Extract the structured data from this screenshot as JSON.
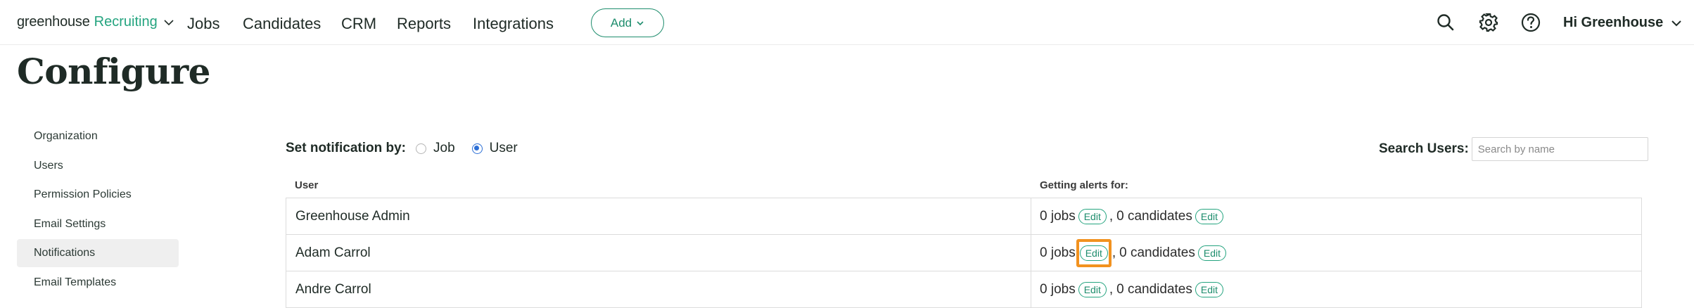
{
  "nav": {
    "brand_main": "greenhouse",
    "brand_sub": "Recruiting",
    "links": [
      "Jobs",
      "Candidates",
      "CRM",
      "Reports",
      "Integrations"
    ],
    "add_label": "Add",
    "user_label": "Hi Greenhouse"
  },
  "page": {
    "title": "Configure"
  },
  "sidebar": {
    "items": [
      {
        "label": "Organization",
        "active": false
      },
      {
        "label": "Users",
        "active": false
      },
      {
        "label": "Permission Policies",
        "active": false
      },
      {
        "label": "Email Settings",
        "active": false
      },
      {
        "label": "Notifications",
        "active": true
      },
      {
        "label": "Email Templates",
        "active": false
      }
    ]
  },
  "notifications": {
    "set_by_label": "Set notification by:",
    "options": [
      "Job",
      "User"
    ],
    "selected": "User",
    "search_label": "Search Users:",
    "search_placeholder": "Search by name",
    "search_value": ""
  },
  "table": {
    "columns": [
      "User",
      "Getting alerts for:"
    ],
    "rows": [
      {
        "user": "Greenhouse Admin",
        "jobs": "0 jobs",
        "candidates": "0 candidates"
      },
      {
        "user": "Adam Carrol",
        "jobs": "0 jobs",
        "candidates": "0 candidates"
      },
      {
        "user": "Andre Carrol",
        "jobs": "0 jobs",
        "candidates": "0 candidates"
      }
    ],
    "edit_label": "Edit",
    "separator": ","
  },
  "colors": {
    "brand_green": "#24a47f",
    "highlight_orange": "#f2921f",
    "radio_blue": "#2c6fd6"
  },
  "icons": [
    "chevron-down-icon",
    "search-icon",
    "gear-icon",
    "help-icon"
  ]
}
